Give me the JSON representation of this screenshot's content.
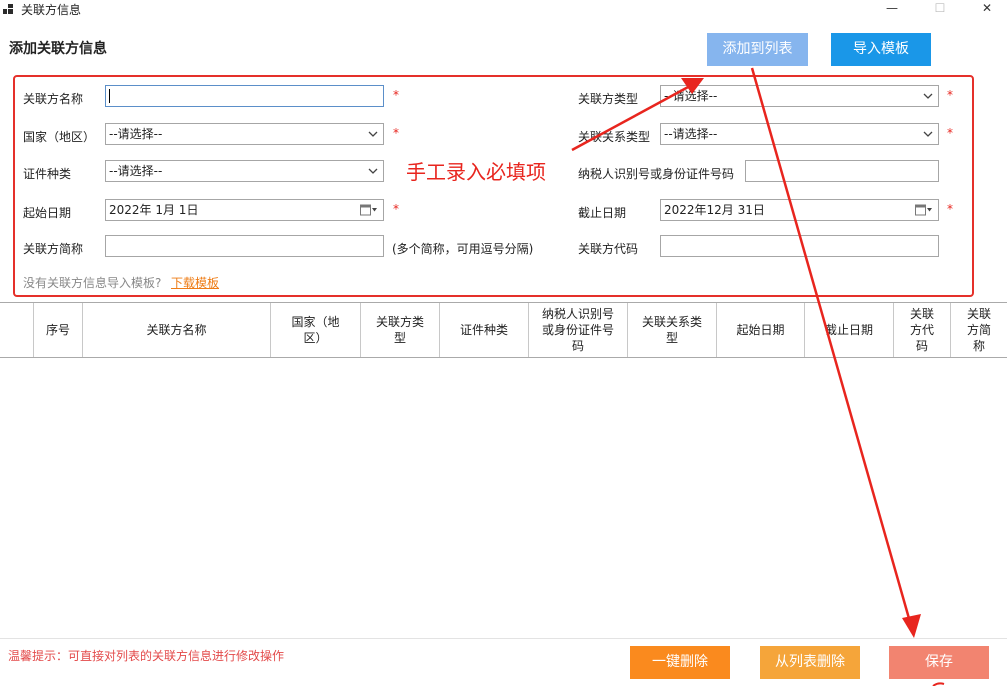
{
  "window": {
    "title": "关联方信息",
    "minimize": "—",
    "maximize": "☐",
    "close": "✕"
  },
  "section_title": "添加关联方信息",
  "top_buttons": {
    "add_to_list": "添加到列表",
    "import_template": "导入模板"
  },
  "form": {
    "name_label": "关联方名称",
    "name_value": "",
    "type_label": "关联方类型",
    "type_value": "--请选择--",
    "country_label": "国家（地区）",
    "country_value": "--请选择--",
    "relation_label": "关联关系类型",
    "relation_value": "--请选择--",
    "cert_label": "证件种类",
    "cert_value": "--请选择--",
    "taxid_label": "纳税人识别号或身份证件号码",
    "taxid_value": "",
    "start_label": "起始日期",
    "start_value": "2022年  1月   1日",
    "end_label": "截止日期",
    "end_value": "2022年12月 31日",
    "abbr_label": "关联方简称",
    "abbr_value": "",
    "abbr_hint": "(多个简称，可用逗号分隔)",
    "code_label": "关联方代码",
    "code_value": "",
    "required_mark": "*",
    "no_template_text": "没有关联方信息导入模板?",
    "download_link": "下载模板"
  },
  "annotation": {
    "text": "手工录入必填项"
  },
  "table": {
    "columns": [
      "序号",
      "关联方名称",
      "国家（地区）",
      "关联方类型",
      "证件种类",
      "纳税人识别号或身份证件号码",
      "关联关系类型",
      "起始日期",
      "截止日期",
      "关联方代码",
      "关联方简称"
    ]
  },
  "tip": "温馨提示：可直接对列表的关联方信息进行修改操作",
  "bottom_buttons": {
    "delete_all": "一键删除",
    "remove_from_list": "从列表删除",
    "save": "保存"
  },
  "colors": {
    "accent_blue": "#1a97e8",
    "light_blue": "#86b5ee",
    "orange": "#fa8a1e",
    "light_orange": "#f5a53a",
    "salmon": "#f28470",
    "red_annotation": "#e5302a"
  },
  "icons": [
    "app-icon",
    "chevron-down-icon",
    "calendar-icon",
    "minimize-icon",
    "maximize-icon",
    "close-icon",
    "arrow-icon"
  ]
}
